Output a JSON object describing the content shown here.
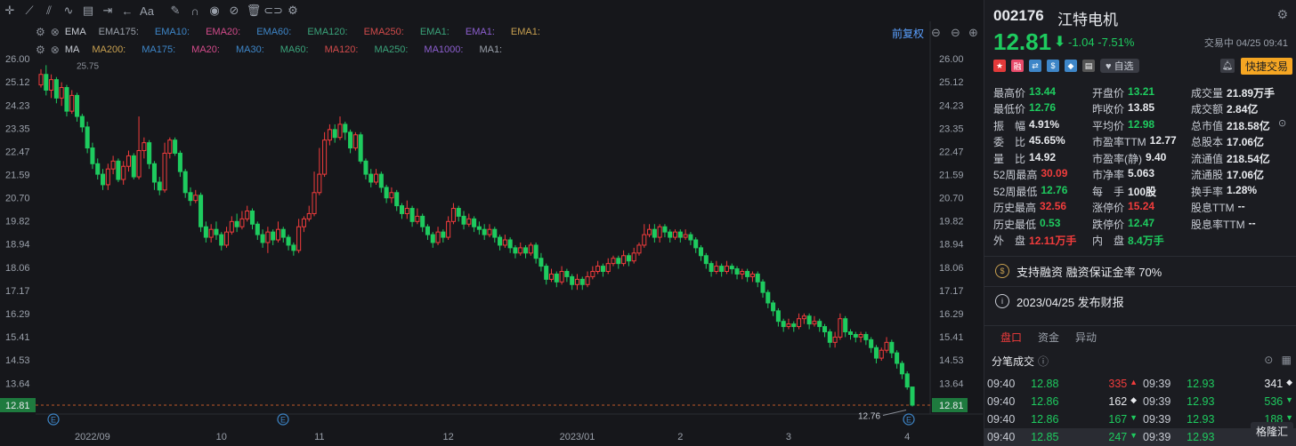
{
  "toolbar": {
    "icons": [
      "crosshair-icon",
      "trendline-icon",
      "parallel-channel-icon",
      "wave-icon",
      "fib-icon",
      "measure-icon",
      "arrow-left-icon",
      "text-icon",
      "sep",
      "pen-icon",
      "magnet-icon",
      "eye-icon",
      "hide-icon",
      "trash-icon",
      "link-icon",
      "settings-icon"
    ],
    "text_label": "Aa"
  },
  "indicators": {
    "ema": {
      "name": "EMA",
      "items": [
        "EMA175:",
        "EMA10:",
        "EMA20:",
        "EMA60:",
        "EMA120:",
        "EMA250:",
        "EMA1:",
        "EMA1:",
        "EMA1:"
      ],
      "colors": [
        "#9aa0aa",
        "#3e86c8",
        "#d24b8a",
        "#3e86c8",
        "#3aa37a",
        "#d24b4b",
        "#3aa37a",
        "#8d5fd0",
        "#c8a050"
      ]
    },
    "ma": {
      "name": "MA",
      "items": [
        "MA200:",
        "MA175:",
        "MA20:",
        "MA30:",
        "MA60:",
        "MA120:",
        "MA250:",
        "MA1000:",
        "MA1:"
      ],
      "colors": [
        "#c8a050",
        "#3e86c8",
        "#d24b8a",
        "#3e86c8",
        "#3aa37a",
        "#d24b4b",
        "#3aa37a",
        "#8d5fd0",
        "#9aa0aa"
      ]
    }
  },
  "adjust_label": "前复权",
  "chart_data": {
    "type": "candlestick",
    "title": "",
    "y_ticks": [
      "26.00",
      "25.12",
      "24.23",
      "23.35",
      "22.47",
      "21.59",
      "20.70",
      "19.82",
      "18.94",
      "18.06",
      "17.17",
      "16.29",
      "15.41",
      "14.53",
      "13.64",
      "12.81"
    ],
    "ylim": [
      12.81,
      26.0
    ],
    "x_ticks": [
      "2022/09",
      "10",
      "11",
      "12",
      "2023/01",
      "2",
      "3",
      "4"
    ],
    "x_tick_bars": [
      10,
      35,
      54,
      79,
      104,
      124,
      145,
      168
    ],
    "last_price": 12.81,
    "annotations": {
      "high_label": "25.75",
      "low_label": "12.76"
    },
    "candles": [
      [
        25.0,
        25.4,
        25.6,
        24.9
      ],
      [
        25.4,
        24.8,
        25.75,
        24.6
      ],
      [
        24.8,
        25.2,
        25.4,
        24.5
      ],
      [
        25.2,
        24.5,
        25.3,
        24.3
      ],
      [
        24.5,
        24.9,
        25.1,
        24.2
      ],
      [
        24.9,
        24.0,
        25.0,
        23.8
      ],
      [
        24.0,
        24.6,
        24.8,
        23.9
      ],
      [
        24.6,
        23.8,
        24.7,
        23.6
      ],
      [
        23.8,
        23.4,
        23.9,
        23.2
      ],
      [
        23.4,
        22.6,
        23.6,
        22.4
      ],
      [
        22.6,
        22.0,
        22.8,
        21.8
      ],
      [
        22.0,
        21.6,
        22.2,
        21.4
      ],
      [
        21.6,
        21.2,
        21.8,
        21.0
      ],
      [
        21.2,
        21.8,
        22.0,
        21.0
      ],
      [
        21.8,
        22.1,
        22.3,
        21.6
      ],
      [
        22.1,
        21.4,
        22.2,
        21.3
      ],
      [
        21.4,
        21.9,
        22.1,
        21.2
      ],
      [
        21.9,
        22.3,
        22.5,
        21.7
      ],
      [
        22.3,
        21.5,
        22.4,
        21.4
      ],
      [
        21.5,
        22.5,
        23.8,
        21.4
      ],
      [
        22.5,
        22.8,
        23.0,
        22.2
      ],
      [
        22.8,
        22.0,
        22.9,
        21.8
      ],
      [
        22.0,
        21.3,
        22.1,
        21.0
      ],
      [
        21.3,
        21.0,
        21.5,
        20.8
      ],
      [
        21.0,
        22.4,
        22.8,
        20.9
      ],
      [
        22.4,
        22.9,
        23.0,
        22.2
      ],
      [
        22.9,
        22.4,
        23.0,
        22.3
      ],
      [
        22.4,
        21.7,
        22.5,
        21.5
      ],
      [
        21.7,
        20.9,
        21.8,
        20.7
      ],
      [
        20.9,
        20.6,
        21.1,
        20.4
      ],
      [
        20.6,
        20.8,
        21.0,
        20.5
      ],
      [
        20.8,
        19.6,
        20.9,
        19.4
      ],
      [
        19.6,
        19.2,
        19.8,
        19.0
      ],
      [
        19.2,
        19.5,
        19.7,
        19.0
      ],
      [
        19.5,
        19.3,
        19.8,
        19.1
      ],
      [
        19.3,
        18.9,
        19.4,
        18.7
      ],
      [
        18.9,
        19.4,
        19.6,
        18.8
      ],
      [
        19.4,
        19.8,
        20.0,
        19.3
      ],
      [
        19.8,
        19.6,
        20.1,
        19.4
      ],
      [
        19.6,
        19.9,
        20.2,
        19.5
      ],
      [
        19.9,
        20.2,
        20.4,
        19.8
      ],
      [
        20.2,
        19.7,
        20.3,
        19.5
      ],
      [
        19.7,
        19.3,
        19.8,
        19.1
      ],
      [
        19.3,
        19.0,
        19.5,
        18.8
      ],
      [
        19.0,
        19.4,
        19.6,
        18.6
      ],
      [
        19.4,
        19.1,
        19.5,
        18.9
      ],
      [
        19.1,
        19.5,
        19.8,
        19.0
      ],
      [
        19.5,
        19.2,
        19.6,
        19.0
      ],
      [
        19.2,
        18.9,
        19.3,
        18.7
      ],
      [
        18.9,
        18.7,
        19.0,
        18.5
      ],
      [
        18.7,
        19.6,
        19.9,
        18.6
      ],
      [
        19.6,
        19.9,
        20.0,
        19.4
      ],
      [
        19.9,
        20.1,
        20.4,
        19.8
      ],
      [
        20.1,
        20.9,
        21.7,
        20.0
      ],
      [
        20.9,
        21.6,
        22.6,
        20.8
      ],
      [
        21.6,
        22.9,
        23.2,
        21.5
      ],
      [
        22.9,
        23.3,
        23.5,
        22.7
      ],
      [
        23.3,
        23.0,
        23.5,
        22.8
      ],
      [
        23.0,
        23.5,
        23.8,
        22.9
      ],
      [
        23.5,
        23.2,
        23.6,
        22.9
      ],
      [
        23.2,
        22.6,
        23.3,
        22.4
      ],
      [
        22.6,
        23.1,
        23.2,
        22.5
      ],
      [
        23.1,
        22.1,
        23.2,
        22.0
      ],
      [
        22.1,
        21.6,
        22.2,
        21.4
      ],
      [
        21.6,
        21.3,
        21.8,
        21.1
      ],
      [
        21.3,
        21.6,
        21.8,
        21.2
      ],
      [
        21.6,
        21.1,
        21.7,
        20.9
      ],
      [
        21.1,
        20.7,
        21.2,
        20.5
      ],
      [
        20.7,
        20.9,
        21.1,
        20.5
      ],
      [
        20.9,
        20.4,
        21.0,
        20.2
      ],
      [
        20.4,
        20.1,
        20.5,
        19.9
      ],
      [
        20.1,
        20.3,
        20.6,
        19.9
      ],
      [
        20.3,
        19.8,
        20.4,
        19.6
      ],
      [
        19.8,
        20.0,
        20.3,
        19.7
      ],
      [
        20.0,
        19.6,
        20.1,
        19.4
      ],
      [
        19.6,
        19.3,
        19.7,
        19.1
      ],
      [
        19.3,
        19.0,
        19.4,
        18.8
      ],
      [
        19.0,
        19.4,
        19.6,
        18.9
      ],
      [
        19.4,
        19.2,
        19.5,
        19.0
      ],
      [
        19.2,
        19.8,
        20.0,
        19.1
      ],
      [
        19.8,
        20.3,
        20.5,
        19.7
      ],
      [
        20.3,
        20.0,
        20.4,
        19.8
      ],
      [
        20.0,
        19.7,
        20.2,
        19.5
      ],
      [
        19.7,
        19.9,
        20.1,
        19.6
      ],
      [
        19.9,
        19.6,
        20.0,
        19.4
      ],
      [
        19.6,
        19.5,
        19.8,
        19.3
      ],
      [
        19.5,
        19.3,
        19.7,
        19.1
      ],
      [
        19.3,
        19.5,
        19.7,
        19.2
      ],
      [
        19.5,
        19.2,
        19.6,
        19.0
      ],
      [
        19.2,
        18.9,
        19.3,
        18.7
      ],
      [
        18.9,
        19.1,
        19.3,
        18.8
      ],
      [
        19.1,
        18.8,
        19.2,
        18.6
      ],
      [
        18.8,
        18.6,
        18.9,
        18.4
      ],
      [
        18.6,
        18.8,
        19.0,
        18.5
      ],
      [
        18.8,
        18.6,
        18.9,
        18.4
      ],
      [
        18.6,
        18.9,
        19.0,
        18.5
      ],
      [
        18.9,
        18.4,
        19.0,
        18.2
      ],
      [
        18.4,
        18.1,
        18.6,
        17.9
      ],
      [
        18.1,
        17.6,
        18.2,
        17.4
      ],
      [
        17.6,
        17.8,
        18.0,
        17.5
      ],
      [
        17.8,
        17.5,
        17.9,
        17.3
      ],
      [
        17.5,
        17.9,
        18.1,
        17.4
      ],
      [
        17.9,
        17.7,
        18.0,
        17.5
      ],
      [
        17.7,
        17.4,
        17.8,
        17.2
      ],
      [
        17.4,
        17.6,
        17.8,
        17.2
      ],
      [
        17.6,
        17.4,
        17.7,
        17.2
      ],
      [
        17.4,
        17.7,
        17.9,
        17.3
      ],
      [
        17.7,
        17.9,
        18.1,
        17.6
      ],
      [
        17.9,
        18.1,
        18.3,
        17.8
      ],
      [
        18.1,
        17.9,
        18.2,
        17.7
      ],
      [
        17.9,
        18.2,
        18.4,
        17.8
      ],
      [
        18.2,
        18.4,
        18.5,
        18.1
      ],
      [
        18.4,
        18.2,
        18.5,
        18.0
      ],
      [
        18.2,
        18.5,
        18.7,
        18.1
      ],
      [
        18.5,
        18.3,
        18.6,
        18.1
      ],
      [
        18.3,
        18.6,
        18.8,
        18.2
      ],
      [
        18.6,
        18.9,
        19.0,
        18.5
      ],
      [
        18.9,
        19.3,
        19.7,
        18.8
      ],
      [
        19.3,
        19.5,
        19.7,
        19.2
      ],
      [
        19.5,
        19.2,
        19.7,
        19.0
      ],
      [
        19.2,
        19.6,
        19.7,
        19.0
      ],
      [
        19.6,
        19.4,
        19.7,
        19.2
      ],
      [
        19.4,
        19.2,
        19.5,
        19.0
      ],
      [
        19.2,
        19.4,
        19.5,
        19.1
      ],
      [
        19.4,
        19.2,
        19.5,
        19.0
      ],
      [
        19.2,
        19.3,
        19.5,
        19.1
      ],
      [
        19.3,
        19.1,
        19.4,
        18.9
      ],
      [
        19.1,
        18.8,
        19.2,
        18.6
      ],
      [
        18.8,
        18.5,
        18.9,
        18.3
      ],
      [
        18.5,
        18.2,
        18.6,
        18.0
      ],
      [
        18.2,
        17.9,
        18.3,
        17.7
      ],
      [
        17.9,
        18.1,
        18.3,
        17.8
      ],
      [
        18.1,
        17.9,
        18.2,
        17.7
      ],
      [
        17.9,
        18.1,
        18.3,
        17.8
      ],
      [
        18.1,
        18.0,
        18.2,
        17.8
      ],
      [
        18.0,
        17.8,
        18.1,
        17.6
      ],
      [
        17.8,
        17.9,
        18.0,
        17.6
      ],
      [
        17.9,
        17.7,
        18.0,
        17.5
      ],
      [
        17.7,
        17.8,
        17.9,
        17.5
      ],
      [
        17.8,
        17.5,
        17.9,
        17.3
      ],
      [
        17.5,
        17.1,
        17.6,
        16.9
      ],
      [
        17.1,
        16.7,
        17.2,
        16.5
      ],
      [
        16.7,
        16.4,
        16.8,
        16.2
      ],
      [
        16.4,
        16.0,
        16.5,
        15.8
      ],
      [
        16.0,
        15.8,
        16.1,
        15.6
      ],
      [
        15.8,
        15.9,
        16.1,
        15.7
      ],
      [
        15.9,
        15.8,
        16.0,
        15.6
      ],
      [
        15.8,
        16.1,
        16.3,
        15.7
      ],
      [
        16.1,
        16.2,
        16.3,
        15.9
      ],
      [
        16.2,
        15.9,
        16.3,
        15.7
      ],
      [
        15.9,
        16.0,
        16.2,
        15.8
      ],
      [
        16.0,
        15.8,
        16.1,
        15.6
      ],
      [
        15.8,
        15.6,
        15.9,
        15.4
      ],
      [
        15.6,
        15.2,
        15.7,
        15.0
      ],
      [
        15.2,
        15.4,
        15.6,
        15.0
      ],
      [
        15.4,
        16.1,
        16.3,
        15.3
      ],
      [
        16.1,
        15.6,
        16.2,
        15.4
      ],
      [
        15.6,
        15.5,
        15.7,
        15.3
      ],
      [
        15.5,
        15.4,
        15.6,
        15.2
      ],
      [
        15.4,
        15.5,
        15.6,
        15.2
      ],
      [
        15.5,
        15.3,
        15.6,
        15.1
      ],
      [
        15.3,
        15.0,
        15.4,
        14.8
      ],
      [
        15.0,
        14.6,
        15.1,
        14.4
      ],
      [
        14.6,
        14.9,
        15.0,
        14.5
      ],
      [
        14.9,
        15.2,
        15.4,
        14.8
      ],
      [
        15.2,
        14.8,
        15.3,
        14.6
      ],
      [
        14.8,
        14.4,
        14.9,
        14.2
      ],
      [
        14.4,
        14.0,
        14.5,
        13.8
      ],
      [
        14.0,
        13.5,
        14.1,
        13.4
      ],
      [
        13.5,
        12.81,
        13.44,
        12.76
      ]
    ]
  },
  "stock": {
    "code": "002176",
    "name": "江特电机",
    "price": "12.81",
    "change": "-1.04",
    "change_pct": "-7.51%",
    "status": "交易中 04/25 09:41",
    "fav_label": "自选",
    "quick_label": "快捷交易",
    "tags": [
      {
        "icon": "china-flag-icon",
        "color": "#e23a3a",
        "glyph": "★"
      },
      {
        "icon": "margin-icon",
        "color": "#e84a6a",
        "glyph": "融"
      },
      {
        "icon": "connect-icon",
        "color": "#3e86c8",
        "glyph": "⇄"
      },
      {
        "icon": "dollar-icon",
        "color": "#3e86c8",
        "glyph": "$"
      },
      {
        "icon": "tag-icon",
        "color": "#3e86c8",
        "glyph": "◆"
      },
      {
        "icon": "doc-icon",
        "color": "#555",
        "glyph": "▤"
      }
    ]
  },
  "stats": [
    [
      {
        "l": "最高价",
        "v": "13.44",
        "c": "green"
      },
      {
        "l": "开盘价",
        "v": "13.21",
        "c": "green"
      },
      {
        "l": "成交量",
        "v": "21.89万手",
        "c": "wht"
      }
    ],
    [
      {
        "l": "最低价",
        "v": "12.76",
        "c": "green"
      },
      {
        "l": "昨收价",
        "v": "13.85",
        "c": "wht"
      },
      {
        "l": "成交额",
        "v": "2.84亿",
        "c": "wht"
      }
    ],
    [
      {
        "l": "振　幅",
        "v": "4.91%",
        "c": "wht"
      },
      {
        "l": "平均价",
        "v": "12.98",
        "c": "green"
      },
      {
        "l": "总市值",
        "v": "218.58亿",
        "c": "wht"
      }
    ],
    [
      {
        "l": "委　比",
        "v": "45.65%",
        "c": "wht"
      },
      {
        "l": "市盈率TTM",
        "v": "12.77",
        "c": "wht"
      },
      {
        "l": "总股本",
        "v": "17.06亿",
        "c": "wht"
      }
    ],
    [
      {
        "l": "量　比",
        "v": "14.92",
        "c": "wht"
      },
      {
        "l": "市盈率(静)",
        "v": "9.40",
        "c": "wht"
      },
      {
        "l": "流通值",
        "v": "218.54亿",
        "c": "wht"
      }
    ],
    [
      {
        "l": "52周最高",
        "v": "30.09",
        "c": "red"
      },
      {
        "l": "市净率",
        "v": "5.063",
        "c": "wht"
      },
      {
        "l": "流通股",
        "v": "17.06亿",
        "c": "wht"
      }
    ],
    [
      {
        "l": "52周最低",
        "v": "12.76",
        "c": "green"
      },
      {
        "l": "每　手",
        "v": "100股",
        "c": "wht"
      },
      {
        "l": "换手率",
        "v": "1.28%",
        "c": "wht"
      }
    ],
    [
      {
        "l": "历史最高",
        "v": "32.56",
        "c": "red"
      },
      {
        "l": "涨停价",
        "v": "15.24",
        "c": "red"
      },
      {
        "l": "股息TTM",
        "v": "--",
        "c": "wht"
      }
    ],
    [
      {
        "l": "历史最低",
        "v": "0.53",
        "c": "green"
      },
      {
        "l": "跌停价",
        "v": "12.47",
        "c": "green"
      },
      {
        "l": "股息率TTM",
        "v": "--",
        "c": "wht"
      }
    ],
    [
      {
        "l": "外　盘",
        "v": "12.11万手",
        "c": "red"
      },
      {
        "l": "内　盘",
        "v": "8.4万手",
        "c": "green"
      },
      {
        "l": "",
        "v": "",
        "c": "wht"
      }
    ]
  ],
  "info1": "支持融资 融资保证金率 70%",
  "info2": "2023/04/25 发布财报",
  "tabs": [
    "盘口",
    "资金",
    "异动"
  ],
  "ticks_title": "分笔成交",
  "ticks": [
    [
      {
        "t": "09:40",
        "p": "12.88",
        "v": "335",
        "vc": "red",
        "d": "▲",
        "dc": "red"
      },
      {
        "t": "09:39",
        "p": "12.93",
        "v": "341",
        "vc": "wht",
        "d": "◆",
        "dc": "wht"
      }
    ],
    [
      {
        "t": "09:40",
        "p": "12.86",
        "v": "162",
        "vc": "wht",
        "d": "◆",
        "dc": "wht"
      },
      {
        "t": "09:39",
        "p": "12.93",
        "v": "536",
        "vc": "green",
        "d": "▼",
        "dc": "green"
      }
    ],
    [
      {
        "t": "09:40",
        "p": "12.86",
        "v": "167",
        "vc": "green",
        "d": "▼",
        "dc": "green"
      },
      {
        "t": "09:39",
        "p": "12.93",
        "v": "188",
        "vc": "green",
        "d": "▼",
        "dc": "green"
      }
    ],
    [
      {
        "t": "09:40",
        "p": "12.85",
        "v": "247",
        "vc": "green",
        "d": "▼",
        "dc": "green"
      },
      {
        "t": "09:39",
        "p": "12.93",
        "v": "",
        "vc": "wht",
        "d": "",
        "dc": "wht"
      }
    ]
  ],
  "logo": "格隆汇"
}
